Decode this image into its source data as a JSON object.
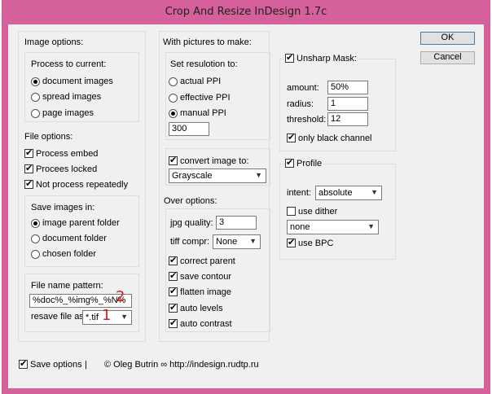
{
  "window": {
    "title": "Crop And Resize InDesign 1.7c"
  },
  "buttons": {
    "ok": "OK",
    "cancel": "Cancel"
  },
  "image_options": {
    "title": "Image options:",
    "process_label": "Process to current:",
    "process_choices": [
      "document images",
      "spread images",
      "page images"
    ],
    "process_selected": "document images"
  },
  "file_options": {
    "title": "File options:",
    "process_embed": {
      "label": "Process embed",
      "checked": true
    },
    "process_locked": {
      "label": "Procees locked",
      "checked": true
    },
    "not_repeatedly": {
      "label": "Not process repeatedly",
      "checked": true
    },
    "save_label": "Save images in:",
    "save_choices": [
      "image parent folder",
      "document folder",
      "chosen folder"
    ],
    "save_selected": "image parent folder"
  },
  "file_name": {
    "label": "File name pattern:",
    "pattern_value": "%doc%_%img%_%N%",
    "marker_2": "2",
    "resave_label": "resave file as:",
    "resave_value": "*.tif",
    "marker_1": "1"
  },
  "pictures": {
    "title": "With pictures to make:",
    "resolution_label": "Set resulotion to:",
    "resolution_choices": [
      "actual PPI",
      "effective PPI",
      "manual PPI"
    ],
    "resolution_selected": "manual PPI",
    "manual_value": "300",
    "convert": {
      "label": "convert image to:",
      "checked": true
    },
    "convert_value": "Grayscale"
  },
  "over_options": {
    "title": "Over options:",
    "jpg_label": "jpg quality:",
    "jpg_value": "3",
    "tiff_label": "tiff compr:",
    "tiff_value": "None",
    "checks": [
      {
        "label": "correct parent",
        "checked": true
      },
      {
        "label": "save contour",
        "checked": true
      },
      {
        "label": "flatten image",
        "checked": true
      },
      {
        "label": "auto levels",
        "checked": true
      },
      {
        "label": "auto contrast",
        "checked": true
      }
    ]
  },
  "unsharp": {
    "label": "Unsharp Mask:",
    "checked": true,
    "amount_label": "amount:",
    "amount_value": "50%",
    "radius_label": "radius:",
    "radius_value": "1",
    "threshold_label": "threshold:",
    "threshold_value": "12",
    "only_black": {
      "label": "only black channel",
      "checked": true
    }
  },
  "profile": {
    "label": "Profile",
    "checked": true,
    "intent_label": "intent:",
    "intent_value": "absolute",
    "use_dither": {
      "label": "use dither",
      "checked": false
    },
    "profile_value": "none",
    "use_bpc": {
      "label": "use BPC",
      "checked": true
    }
  },
  "footer": {
    "save_options": {
      "label": "Save options",
      "checked": true
    },
    "separator": "|",
    "credit": "© Oleg Butrin ∞ http://indesign.rudtp.ru"
  },
  "colors": {
    "titlebar": "#d6609a",
    "client": "#f0f0f0",
    "marker": "#d22020",
    "frame": "#d5dfe5"
  }
}
